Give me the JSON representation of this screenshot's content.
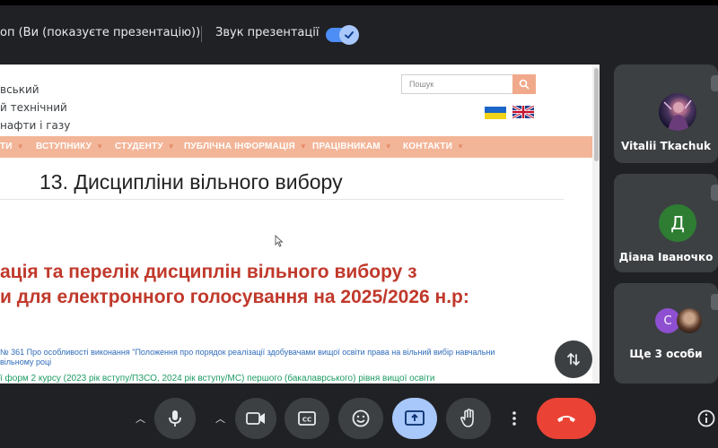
{
  "top_bar": {
    "presenting_text": "оп (Ви (показуєте презентацію))",
    "sound_label": "Звук презентації",
    "sound_enabled": true
  },
  "shared_page": {
    "site_name_lines": [
      "вський",
      "й технічний",
      "нафти і газу"
    ],
    "search_placeholder": "Пошук",
    "nav": {
      "items": [
        "ТИ",
        "ВСТУПНИКУ",
        "СТУДЕНТУ",
        "ПУБЛІЧНА ІНФОРМАЦІЯ",
        "ПРАЦІВНИКАМ",
        "КОНТАКТИ"
      ],
      "caret": "▼"
    },
    "page_title": "13. Дисципліни вільного вибору",
    "red_heading_line1": "ація та перелік дисциплін вільного вибору з",
    "red_heading_line2": "и для електронного голосування на 2025/2026 н.р:",
    "order_text_line1": "№ 361 Про особливості виконання \"Положення про порядок реалізації здобувачами вищої освіти права на вільний вибір навчальни",
    "order_text_line2": "вільному році",
    "green_text": "ї форм 2 курсу (2023 рік вступу/ПЗСО, 2024 рік вступу/МС) першого (бакалаврського) рівня вищої освіти"
  },
  "participants": [
    {
      "name": "Vitalii Tkachuk",
      "avatar": "photo"
    },
    {
      "name": "Діана Іваночко",
      "avatar_letter": "Д",
      "color": "#2e7d32"
    },
    {
      "name": "Ще 3 особи",
      "avatar_letter": "С",
      "color": "#8e4fd1"
    }
  ],
  "controls": {
    "mic": "mic-icon",
    "camera": "camera-icon",
    "captions": "captions-icon",
    "emoji": "emoji-icon",
    "present": "present-icon",
    "raise_hand": "hand-icon",
    "more": "more-icon",
    "leave": "leave-call-icon",
    "info": "info-icon"
  },
  "colors": {
    "accent_blue": "#a8c7fa",
    "leave_red": "#ea4335",
    "nav_bg": "#f3b598",
    "heading_red": "#c0392b"
  }
}
